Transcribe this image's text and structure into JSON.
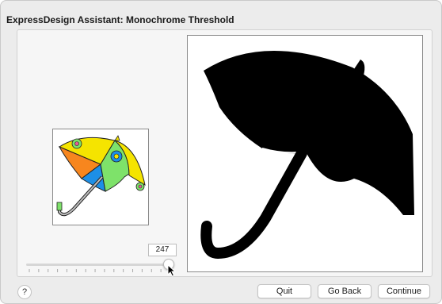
{
  "window": {
    "title": "ExpressDesign Assistant: Monochrome Threshold"
  },
  "threshold": {
    "value": "247",
    "min": 0,
    "max": 255,
    "tick_count": 16
  },
  "images": {
    "thumbnail_icon": "umbrella-color-icon",
    "preview_icon": "umbrella-monochrome-icon"
  },
  "buttons": {
    "help_label": "?",
    "quit_label": "Quit",
    "back_label": "Go Back",
    "continue_label": "Continue"
  },
  "colors": {
    "window_bg": "#ececec",
    "panel_bg": "#f6f6f6",
    "mono_fill": "#000000",
    "umbrella_yellow": "#f5e400",
    "umbrella_orange": "#f7861e",
    "umbrella_blue": "#1d8fe6",
    "umbrella_green": "#7ee26a",
    "umbrella_pink": "#e85c9a"
  }
}
